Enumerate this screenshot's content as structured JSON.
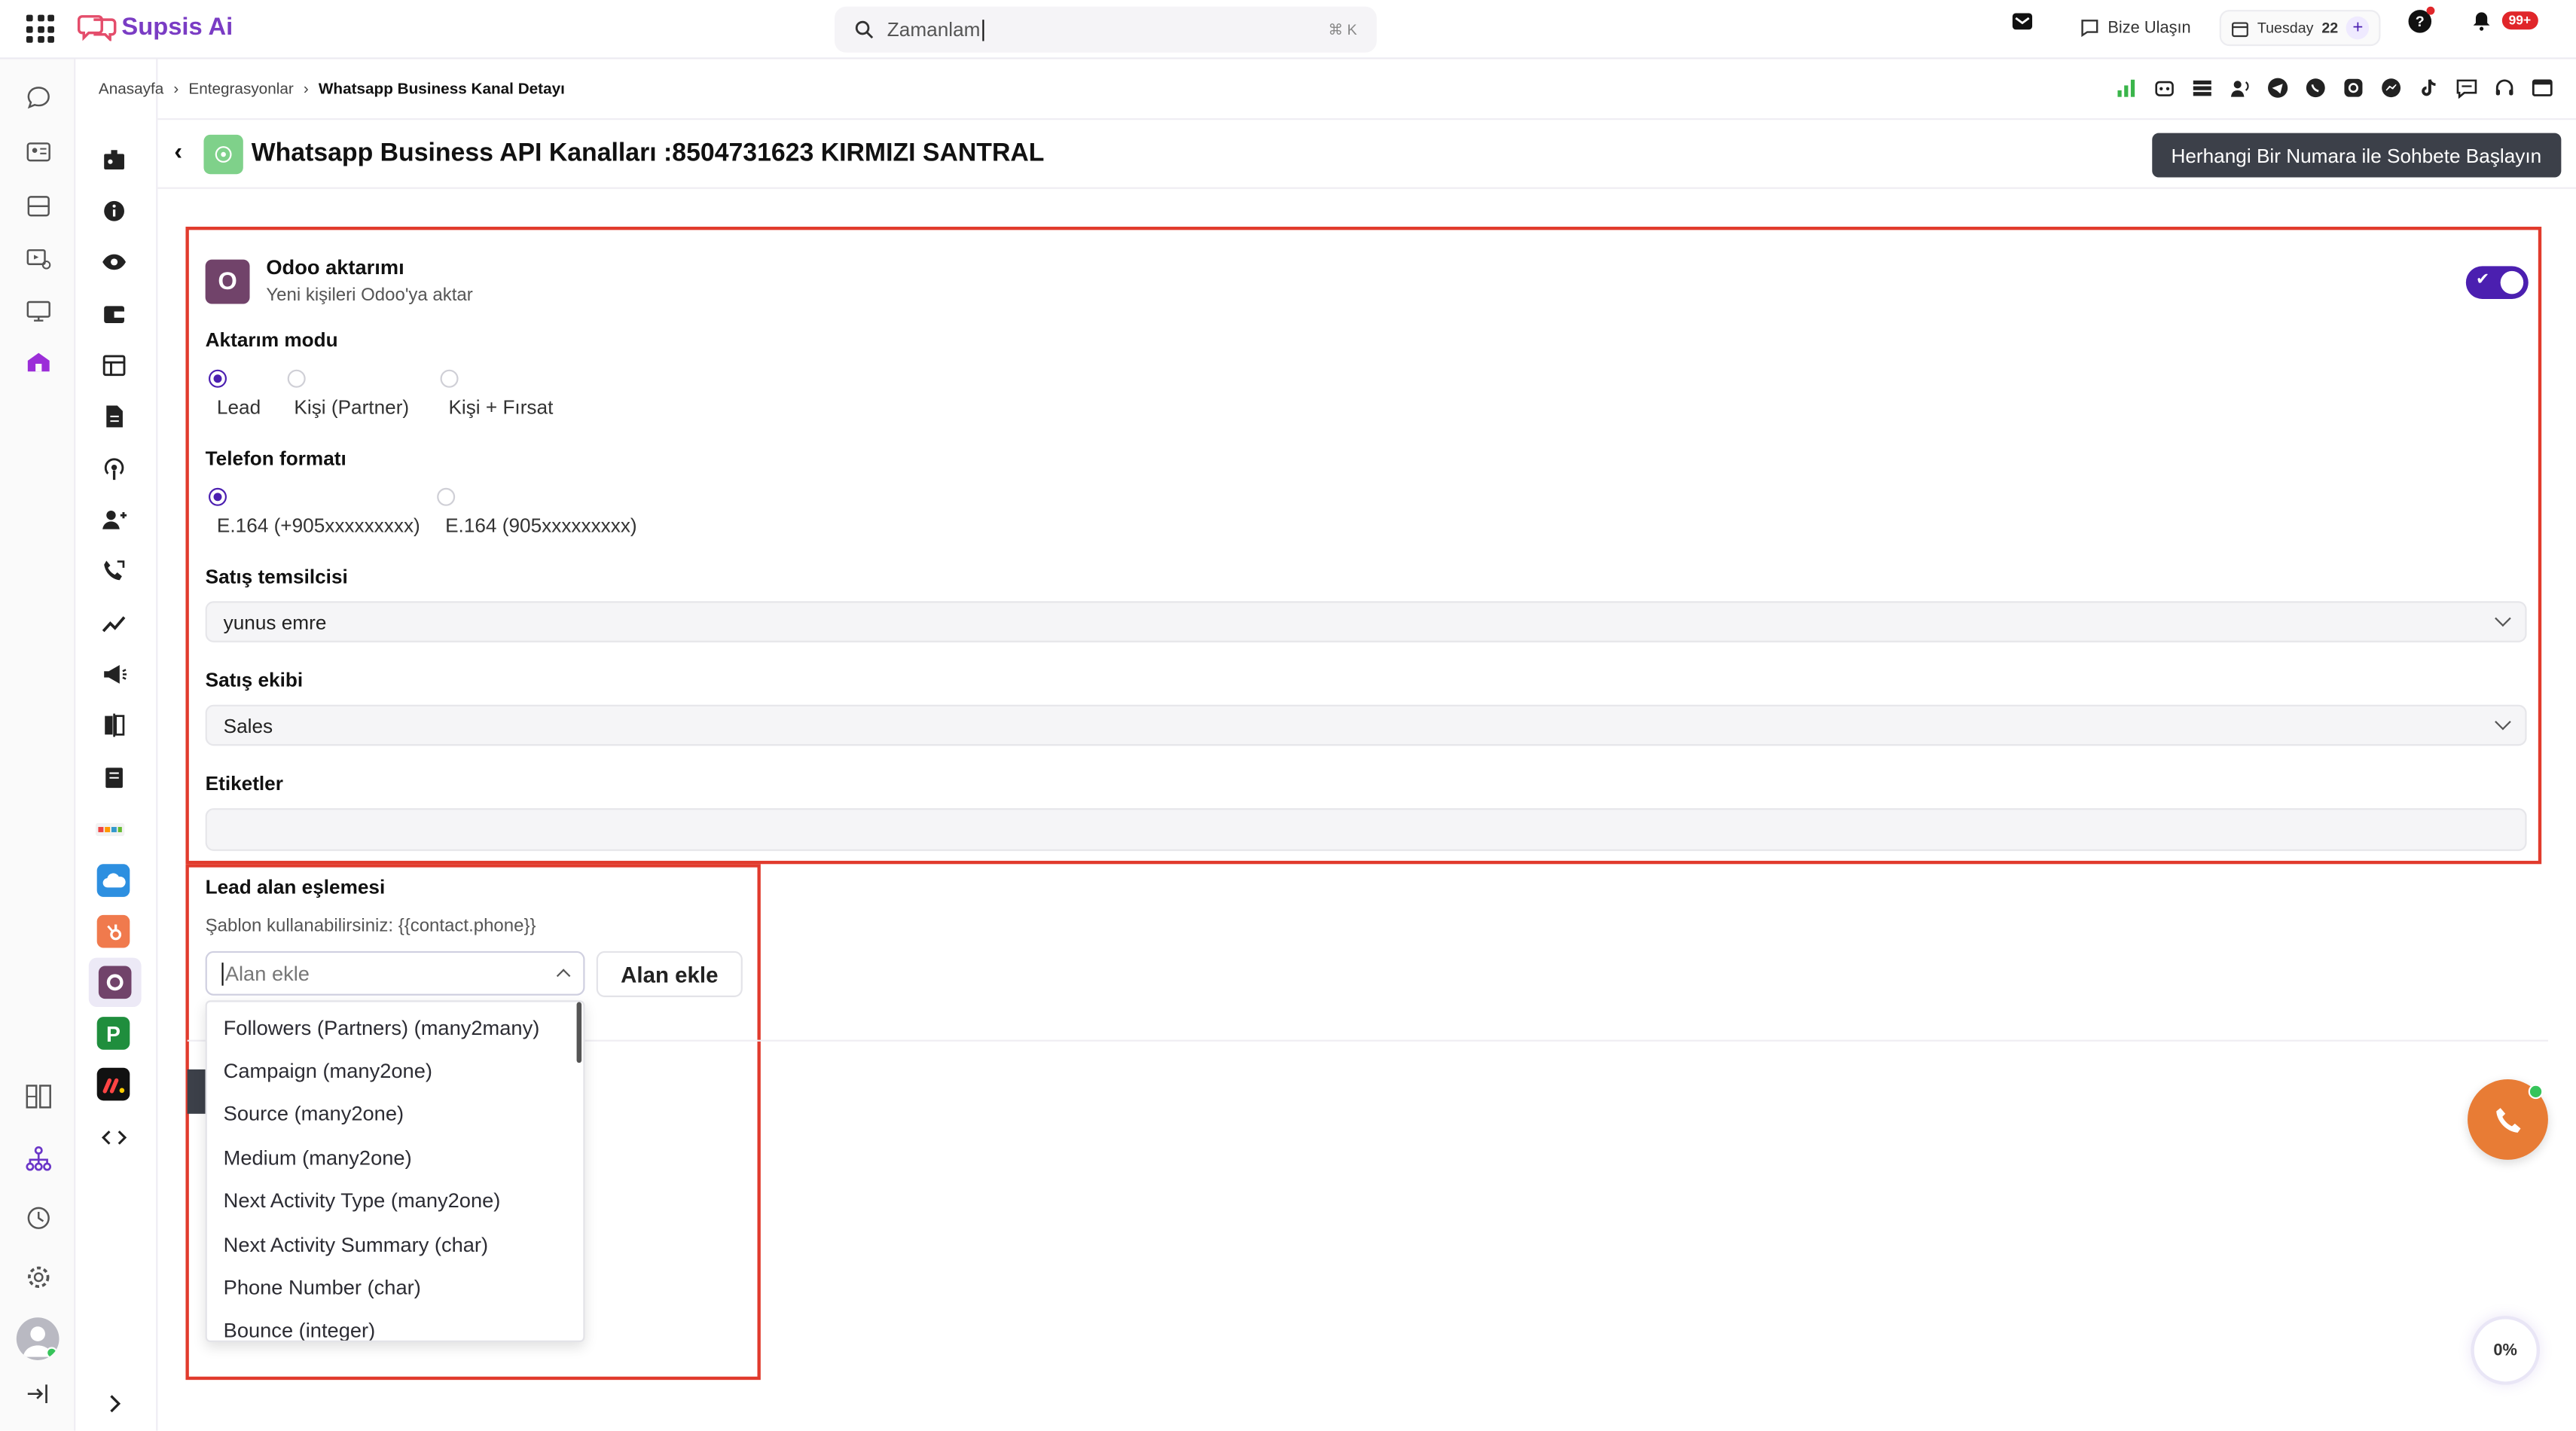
{
  "app": {
    "name": "Supsis Ai"
  },
  "search": {
    "placeholder": "Zamanlam",
    "shortcut": "⌘ K"
  },
  "topbar": {
    "contact_label": "Bize Ulaşın",
    "date_day": "Tuesday",
    "date_num": "22",
    "notif_count": "99+"
  },
  "breadcrumb": {
    "items": [
      "Anasayfa",
      "Entegrasyonlar",
      "Whatsapp Business Kanal Detayı"
    ]
  },
  "header": {
    "title": "Whatsapp Business API Kanalları :8504731623 KIRMIZI SANTRAL",
    "start_button": "Herhangi Bir Numara ile Sohbete Başlayın"
  },
  "odoo": {
    "title": "Odoo aktarımı",
    "subtitle": "Yeni kişileri Odoo'ya aktar",
    "enabled": true,
    "logo_letter": "O",
    "transfer_mode": {
      "label": "Aktarım modu",
      "options": [
        "Lead",
        "Kişi (Partner)",
        "Kişi + Fırsat"
      ],
      "selected": "Lead"
    },
    "phone_format": {
      "label": "Telefon formatı",
      "options": [
        "E.164 (+905xxxxxxxxx)",
        "E.164 (905xxxxxxxxx)"
      ],
      "selected": "E.164 (+905xxxxxxxxx)"
    },
    "sales_rep": {
      "label": "Satış temsilcisi",
      "value": "yunus emre"
    },
    "sales_team": {
      "label": "Satış ekibi",
      "value": "Sales"
    },
    "tags": {
      "label": "Etiketler",
      "value": ""
    }
  },
  "lead_mapping": {
    "title": "Lead alan eşlemesi",
    "hint": "Şablon kullanabilirsiniz: {{contact.phone}}",
    "field_placeholder": "Alan ekle",
    "add_button": "Alan ekle",
    "dropdown_options": [
      "Followers (Partners) (many2many)",
      "Campaign (many2one)",
      "Source (many2one)",
      "Medium (many2one)",
      "Next Activity Type (many2one)",
      "Next Activity Summary (char)",
      "Phone Number (char)",
      "Bounce (integer)"
    ]
  },
  "progress": {
    "label": "0%",
    "value": 0
  },
  "colors": {
    "accent": "#4b1fb0",
    "brand": "#7a3cc4",
    "highlight": "#e13b2d",
    "call": "#e87c35"
  }
}
